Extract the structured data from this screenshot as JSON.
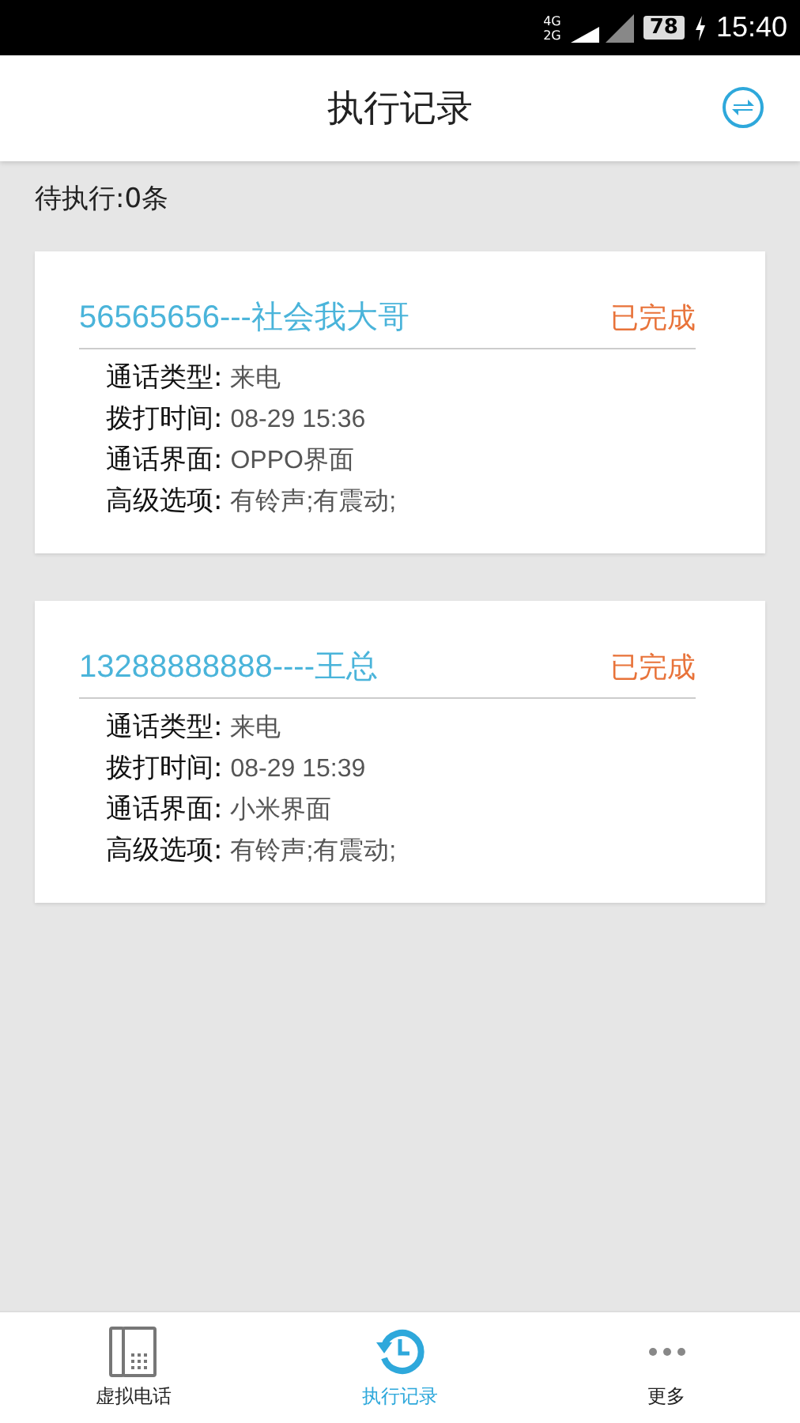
{
  "status_bar": {
    "network_top": "4G",
    "network_bottom": "2G",
    "battery": "78",
    "time": "15:40"
  },
  "header": {
    "title": "执行记录"
  },
  "pending": "待执行:0条",
  "records": [
    {
      "title": "56565656---社会我大哥",
      "status": "已完成",
      "fields": [
        {
          "label": "通话类型:",
          "value": "来电"
        },
        {
          "label": "拨打时间:",
          "value": "08-29 15:36"
        },
        {
          "label": "通话界面:",
          "value": "OPPO界面"
        },
        {
          "label": "高级选项:",
          "value": "有铃声;有震动;"
        }
      ]
    },
    {
      "title": "13288888888----王总",
      "status": "已完成",
      "fields": [
        {
          "label": "通话类型:",
          "value": "来电"
        },
        {
          "label": "拨打时间:",
          "value": "08-29 15:39"
        },
        {
          "label": "通话界面:",
          "value": "小米界面"
        },
        {
          "label": "高级选项:",
          "value": "有铃声;有震动;"
        }
      ]
    }
  ],
  "tabs": [
    {
      "kind": "phone",
      "label": "虚拟电话",
      "selected": false
    },
    {
      "kind": "history",
      "label": "执行记录",
      "selected": true
    },
    {
      "kind": "more",
      "label": "更多",
      "selected": false
    }
  ]
}
